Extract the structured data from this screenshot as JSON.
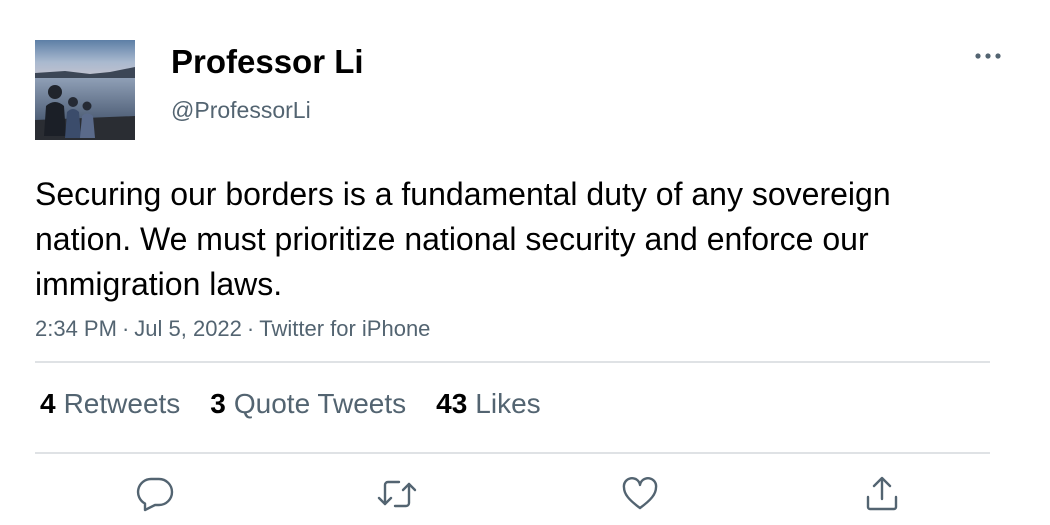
{
  "author": {
    "display_name": "Professor Li",
    "handle": "@ProfessorLi"
  },
  "tweet": {
    "text": "Securing our borders is a fundamental duty of any sovereign nation. We must prioritize national security and enforce our immigration laws.",
    "time": "2:34 PM",
    "separator": "·",
    "date": "Jul 5, 2022",
    "source": "Twitter for iPhone"
  },
  "stats": {
    "retweets_count": "4",
    "retweets_label": "Retweets",
    "quotes_count": "3",
    "quotes_label": "Quote Tweets",
    "likes_count": "43",
    "likes_label": "Likes"
  },
  "actions": {
    "reply_icon": "reply-icon",
    "retweet_icon": "retweet-icon",
    "like_icon": "heart-icon",
    "share_icon": "share-icon"
  },
  "colors": {
    "text_primary": "#000000",
    "text_secondary": "#536471",
    "divider": "#dfe2e5",
    "background": "#ffffff"
  }
}
